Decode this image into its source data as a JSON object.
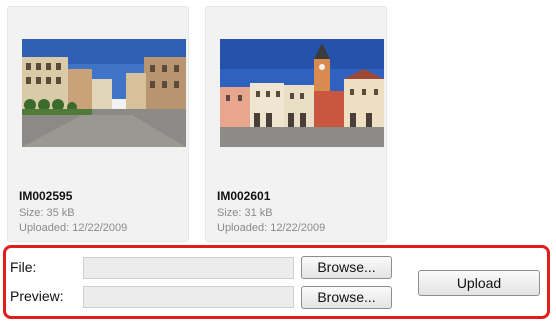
{
  "gallery": {
    "items": [
      {
        "name": "IM002595",
        "size": "Size: 35 kB",
        "uploaded": "Uploaded: 12/22/2009"
      },
      {
        "name": "IM002601",
        "size": "Size: 31 kB",
        "uploaded": "Uploaded: 12/22/2009"
      }
    ]
  },
  "upload": {
    "file_label": "File:",
    "preview_label": "Preview:",
    "file_value": "",
    "preview_value": "",
    "browse_label": "Browse...",
    "upload_label": "Upload",
    "highlight_color": "#e21b1b"
  }
}
